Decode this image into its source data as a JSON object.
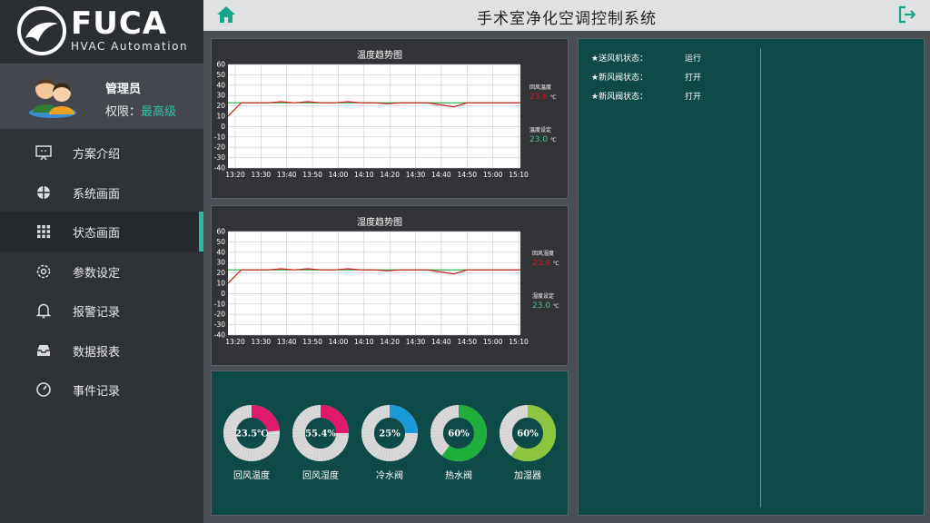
{
  "sidebar": {
    "brand": "FUCA",
    "tagline": "HVAC Automation",
    "user": {
      "name": "管理员",
      "permission_label": "权限：",
      "permission_level": "最高级"
    },
    "menu": [
      {
        "label": "方案介绍",
        "icon": "presentation-icon"
      },
      {
        "label": "系统画面",
        "icon": "fan-icon"
      },
      {
        "label": "状态画面",
        "icon": "grid-icon",
        "active": true
      },
      {
        "label": "参数设定",
        "icon": "gear-icon"
      },
      {
        "label": "报警记录",
        "icon": "bell-icon"
      },
      {
        "label": "数据报表",
        "icon": "inbox-icon"
      },
      {
        "label": "事件记录",
        "icon": "gauge-icon"
      }
    ]
  },
  "header": {
    "title": "手术室净化空调控制系统",
    "home_icon": "home-icon",
    "exit_icon": "exit-icon"
  },
  "charts": [
    {
      "title": "温度趋势图",
      "legend_return_label": "回风温度",
      "legend_return_value": "23.6",
      "legend_set_label": "温度设定",
      "legend_set_value": "23.0",
      "unit": "℃"
    },
    {
      "title": "湿度趋势图",
      "legend_return_label": "回风湿度",
      "legend_return_value": "23.6",
      "legend_set_label": "湿度设定",
      "legend_set_value": "23.0",
      "unit": "℃"
    }
  ],
  "chart_data": [
    {
      "type": "line",
      "title": "温度趋势图",
      "x": [
        "13:20",
        "13:30",
        "13:40",
        "13:50",
        "14:00",
        "14:10",
        "14:20",
        "14:30",
        "14:40",
        "14:50",
        "15:00",
        "15:10"
      ],
      "ylim": [
        -40,
        60
      ],
      "yticks": [
        60,
        50,
        40,
        30,
        20,
        10,
        0,
        -10,
        -20,
        -30,
        -40
      ],
      "grid": true,
      "series": [
        {
          "name": "回风温度",
          "color": "#d01a1a",
          "values": [
            10,
            23,
            23,
            23,
            24,
            23,
            24,
            23,
            23,
            24,
            23,
            23,
            22,
            23,
            23,
            23,
            21,
            19,
            23,
            23,
            23,
            23,
            23
          ]
        },
        {
          "name": "温度设定",
          "color": "#1fae3a",
          "values": [
            23,
            23,
            23,
            23,
            23,
            23,
            23,
            23,
            23,
            23,
            23,
            23,
            23,
            23,
            23,
            23,
            23,
            23,
            23,
            23,
            23,
            23,
            23
          ]
        }
      ]
    },
    {
      "type": "line",
      "title": "湿度趋势图",
      "x": [
        "13:20",
        "13:30",
        "13:40",
        "13:50",
        "14:00",
        "14:10",
        "14:20",
        "14:30",
        "14:40",
        "14:50",
        "15:00",
        "15:10"
      ],
      "ylim": [
        -40,
        60
      ],
      "yticks": [
        60,
        50,
        40,
        30,
        20,
        10,
        0,
        -10,
        -20,
        -30,
        -40
      ],
      "grid": true,
      "series": [
        {
          "name": "回风湿度",
          "color": "#d01a1a",
          "values": [
            10,
            23,
            23,
            23,
            24,
            23,
            24,
            23,
            23,
            24,
            23,
            23,
            22,
            23,
            23,
            23,
            21,
            19,
            23,
            23,
            23,
            23,
            23
          ]
        },
        {
          "name": "湿度设定",
          "color": "#1fae3a",
          "values": [
            23,
            23,
            23,
            23,
            23,
            23,
            23,
            23,
            23,
            23,
            23,
            23,
            23,
            23,
            23,
            23,
            23,
            23,
            23,
            23,
            23,
            23,
            23
          ]
        }
      ]
    }
  ],
  "gauges": [
    {
      "label": "回风温度",
      "value_text": "23.5℃",
      "fraction": 0.235,
      "color": "#e0196a"
    },
    {
      "label": "回风湿度",
      "value_text": "55.4%",
      "fraction": 0.25,
      "color": "#e0196a"
    },
    {
      "label": "冷水阀",
      "value_text": "25%",
      "fraction": 0.25,
      "color": "#1a9bd8"
    },
    {
      "label": "热水阀",
      "value_text": "60%",
      "fraction": 0.6,
      "color": "#1fae3a"
    },
    {
      "label": "加湿器",
      "value_text": "60%",
      "fraction": 0.6,
      "color": "#8cc63f"
    }
  ],
  "status": [
    {
      "label": "★送风机状态：",
      "value": "运行"
    },
    {
      "label": "★新风阀状态：",
      "value": "打开"
    },
    {
      "label": "★新风阀状态：",
      "value": "打开"
    }
  ]
}
